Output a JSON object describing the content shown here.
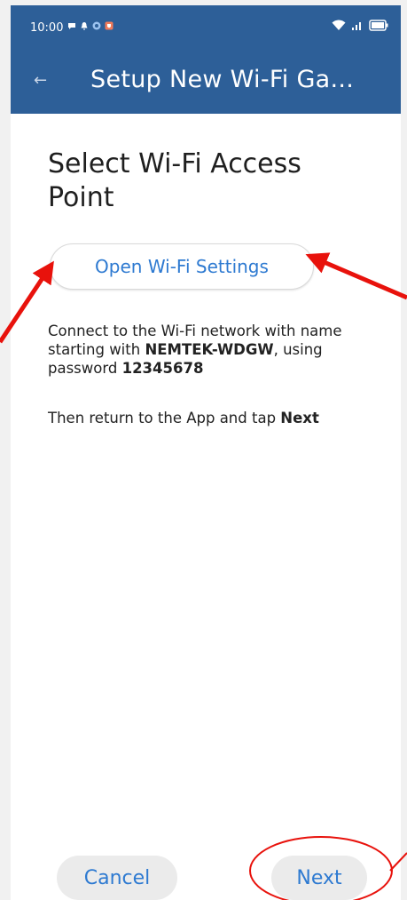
{
  "status_bar": {
    "time": "10:00",
    "notification_icons": [
      "chat-icon",
      "bell-icon",
      "app-icon",
      "shield-icon"
    ],
    "right_icons": [
      "wifi-icon",
      "signal-icon",
      "battery-icon"
    ]
  },
  "app_bar": {
    "back_glyph": "←",
    "title": "Setup New Wi-Fi Ga..."
  },
  "main": {
    "heading": "Select Wi-Fi Access Point",
    "open_settings_label": "Open Wi-Fi Settings",
    "instruction": {
      "part1": "Connect to the Wi-Fi network with name starting with ",
      "network_name": "NEMTEK-WDGW",
      "part2": ", using password ",
      "password": "12345678"
    },
    "return_text": {
      "part1": "Then return to the App and tap ",
      "bold": "Next"
    }
  },
  "footer": {
    "cancel_label": "Cancel",
    "next_label": "Next"
  },
  "annotations": {
    "arrow_color": "#e8120c",
    "circle_color": "#e8120c"
  },
  "colors": {
    "primary": "#2d5f98",
    "accent_text": "#2e7ad1"
  }
}
